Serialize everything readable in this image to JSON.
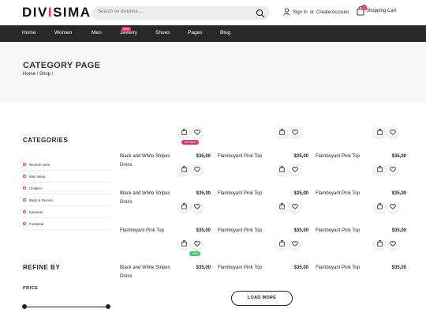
{
  "header": {
    "logo_main": "DIVISIMA",
    "search_placeholder": "Search on divisima ....",
    "sign_in": "Sign In",
    "or": "or",
    "create_account": "Create Account",
    "cart_label": "Shopping Cart",
    "cart_count": "0",
    "accent_color": "#e22d7a"
  },
  "nav": {
    "items": [
      "Home",
      "Women",
      "Men",
      "Jewelry",
      "Shoes",
      "Pages",
      "Blog"
    ],
    "new_badge": "NEW"
  },
  "hero": {
    "title": "CATEGORY PAGE",
    "breadcrumb": "Home / Shop /"
  },
  "sidebar": {
    "categories_title": "CATEGORIES",
    "categories": [
      "Woman wear",
      "Man Wear",
      "Children",
      "Bags & Purses",
      "Eyewear",
      "Footwear"
    ],
    "refine_title": "REFINE BY",
    "price_label": "PRICE"
  },
  "products": [
    {
      "name": "Black and White Stripes Dress",
      "price": "$35,00",
      "tag": "ON SALE"
    },
    {
      "name": "Flamboyant Pink Top",
      "price": "$35,00",
      "tag": ""
    },
    {
      "name": "Flamboyant Pink Top",
      "price": "$35,00",
      "tag": ""
    },
    {
      "name": "Black and White Stripes Dress",
      "price": "$35,00",
      "tag": ""
    },
    {
      "name": "Flamboyant Pink Top",
      "price": "$35,00",
      "tag": ""
    },
    {
      "name": "Flamboyant Pink Top",
      "price": "$35,00",
      "tag": ""
    },
    {
      "name": "Flamboyant Pink Top",
      "price": "$35,00",
      "tag": ""
    },
    {
      "name": "Flamboyant Pink Top",
      "price": "$35,00",
      "tag": ""
    },
    {
      "name": "Flamboyant Pink Top",
      "price": "$35,00",
      "tag": ""
    },
    {
      "name": "Black and White Stripes Dress",
      "price": "$35,00",
      "tag": "NEW"
    },
    {
      "name": "Flamboyant Pink Top",
      "price": "$35,00",
      "tag": ""
    },
    {
      "name": "Flamboyant Pink Top",
      "price": "$35,00",
      "tag": ""
    }
  ],
  "product_icons": [
    "shopping-bag-icon",
    "heart-icon"
  ],
  "load_more": "LOAD MORE"
}
